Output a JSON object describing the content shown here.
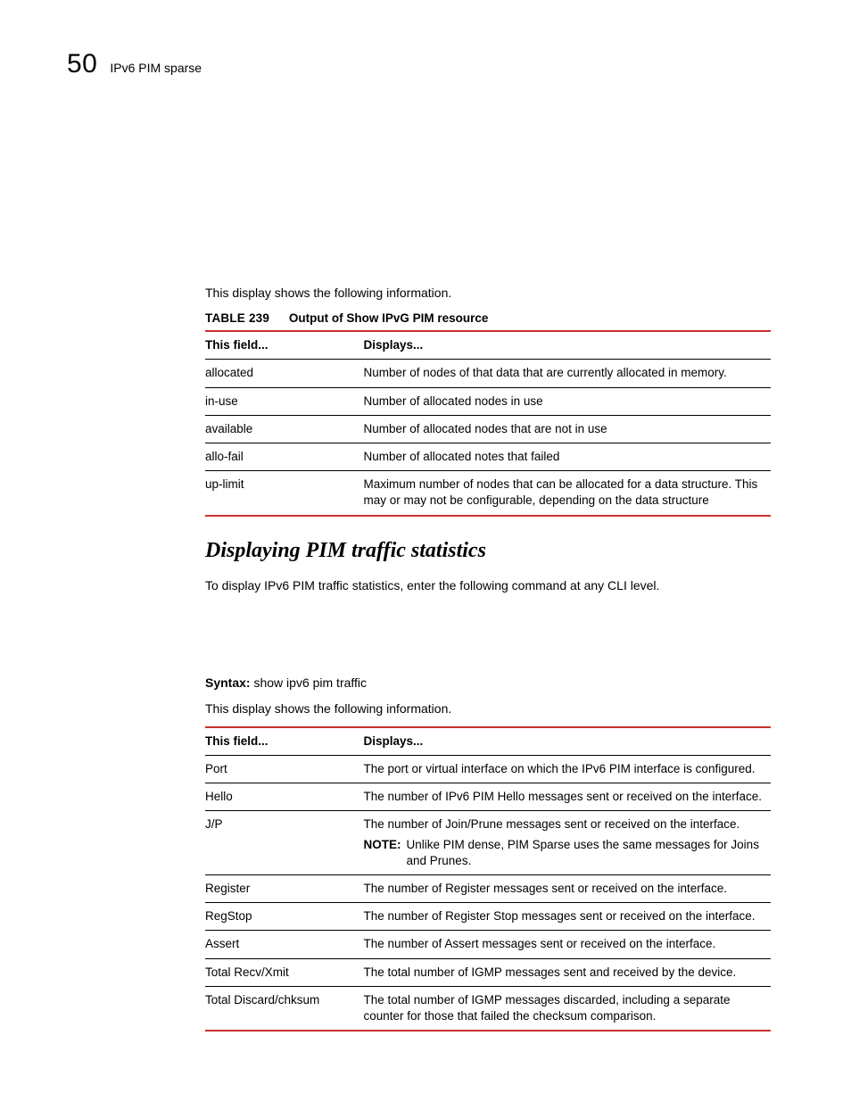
{
  "header": {
    "chapter_number": "50",
    "chapter_title": "IPv6 PIM sparse"
  },
  "intro1": "This display shows the following information.",
  "table239": {
    "label": "TABLE 239",
    "title": "Output of Show IPvG PIM resource",
    "head_field": "This field...",
    "head_displays": "Displays...",
    "rows": [
      {
        "field": "allocated",
        "displays": "Number of nodes of that data that are currently allocated in memory."
      },
      {
        "field": "in-use",
        "displays": "Number of allocated nodes in use"
      },
      {
        "field": "available",
        "displays": "Number of allocated nodes that are not in use"
      },
      {
        "field": "allo-fail",
        "displays": "Number of allocated notes that failed"
      },
      {
        "field": "up-limit",
        "displays": "Maximum number of nodes that can be allocated for a data structure. This may or may not be configurable, depending on the data structure"
      }
    ]
  },
  "section": {
    "heading": "Displaying PIM traffic statistics",
    "para": "To display IPv6 PIM traffic statistics, enter the following command at any CLI level."
  },
  "syntax": {
    "label": "Syntax:",
    "command": "show ipv6 pim traffic"
  },
  "intro2": "This display shows the following information.",
  "table_traffic": {
    "head_field": "This field...",
    "head_displays": "Displays...",
    "rows": [
      {
        "field": "Port",
        "displays": "The port or virtual interface on which the IPv6 PIM interface is configured."
      },
      {
        "field": "Hello",
        "displays": "The number of IPv6 PIM Hello messages sent or received on the interface."
      },
      {
        "field": "J/P",
        "displays": "The number of Join/Prune messages sent or received on the interface.",
        "note_label": "NOTE:",
        "note_text": "Unlike PIM dense, PIM Sparse uses the same messages for Joins and Prunes."
      },
      {
        "field": "Register",
        "displays": "The number of Register messages sent or received on the interface."
      },
      {
        "field": "RegStop",
        "displays": "The number of Register Stop messages sent or received on the interface."
      },
      {
        "field": "Assert",
        "displays": "The number of Assert messages sent or received on the interface."
      },
      {
        "field": "Total Recv/Xmit",
        "displays": "The total number of IGMP messages sent and received by the device."
      },
      {
        "field": "Total Discard/chksum",
        "displays": "The total number of IGMP messages discarded, including a separate counter for those that failed the checksum comparison."
      }
    ]
  }
}
